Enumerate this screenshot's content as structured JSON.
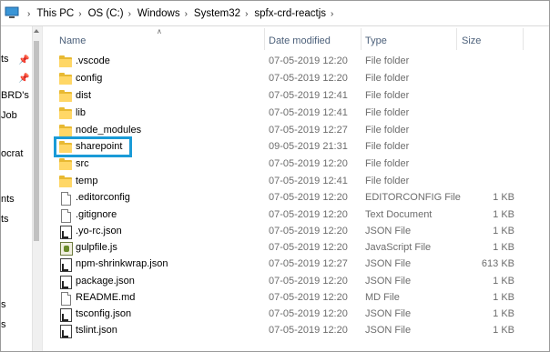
{
  "breadcrumb": {
    "items": [
      "This PC",
      "OS (C:)",
      "Windows",
      "System32",
      "spfx-crd-reactjs"
    ]
  },
  "nav_pane": {
    "items": [
      "ts",
      "BRD's",
      "Job",
      "ocrat",
      "nts",
      "ts",
      "s",
      "s"
    ]
  },
  "columns": {
    "name": "Name",
    "date_modified": "Date modified",
    "type": "Type",
    "size": "Size"
  },
  "files": [
    {
      "name": ".vscode",
      "date": "07-05-2019 12:20",
      "type": "File folder",
      "size": "",
      "icon": "folder-icon"
    },
    {
      "name": "config",
      "date": "07-05-2019 12:20",
      "type": "File folder",
      "size": "",
      "icon": "folder-icon"
    },
    {
      "name": "dist",
      "date": "07-05-2019 12:41",
      "type": "File folder",
      "size": "",
      "icon": "folder-icon"
    },
    {
      "name": "lib",
      "date": "07-05-2019 12:41",
      "type": "File folder",
      "size": "",
      "icon": "folder-icon"
    },
    {
      "name": "node_modules",
      "date": "07-05-2019 12:27",
      "type": "File folder",
      "size": "",
      "icon": "folder-icon"
    },
    {
      "name": "sharepoint",
      "date": "09-05-2019 21:31",
      "type": "File folder",
      "size": "",
      "icon": "folder-icon"
    },
    {
      "name": "src",
      "date": "07-05-2019 12:20",
      "type": "File folder",
      "size": "",
      "icon": "folder-icon"
    },
    {
      "name": "temp",
      "date": "07-05-2019 12:41",
      "type": "File folder",
      "size": "",
      "icon": "folder-icon"
    },
    {
      "name": ".editorconfig",
      "date": "07-05-2019 12:20",
      "type": "EDITORCONFIG File",
      "size": "1 KB",
      "icon": "file-icon"
    },
    {
      "name": ".gitignore",
      "date": "07-05-2019 12:20",
      "type": "Text Document",
      "size": "1 KB",
      "icon": "file-icon"
    },
    {
      "name": ".yo-rc.json",
      "date": "07-05-2019 12:20",
      "type": "JSON File",
      "size": "1 KB",
      "icon": "json-file-icon"
    },
    {
      "name": "gulpfile.js",
      "date": "07-05-2019 12:20",
      "type": "JavaScript File",
      "size": "1 KB",
      "icon": "js-file-icon"
    },
    {
      "name": "npm-shrinkwrap.json",
      "date": "07-05-2019 12:27",
      "type": "JSON File",
      "size": "613 KB",
      "icon": "json-file-icon"
    },
    {
      "name": "package.json",
      "date": "07-05-2019 12:20",
      "type": "JSON File",
      "size": "1 KB",
      "icon": "json-file-icon"
    },
    {
      "name": "README.md",
      "date": "07-05-2019 12:20",
      "type": "MD File",
      "size": "1 KB",
      "icon": "file-icon"
    },
    {
      "name": "tsconfig.json",
      "date": "07-05-2019 12:20",
      "type": "JSON File",
      "size": "1 KB",
      "icon": "json-file-icon"
    },
    {
      "name": "tslint.json",
      "date": "07-05-2019 12:20",
      "type": "JSON File",
      "size": "1 KB",
      "icon": "json-file-icon"
    }
  ],
  "highlighted_item": "sharepoint",
  "colors": {
    "highlight_border": "#1a9bd7",
    "folder": "#ffd766",
    "header_text": "#4c607a",
    "secondary_text": "#6d6d6d"
  }
}
